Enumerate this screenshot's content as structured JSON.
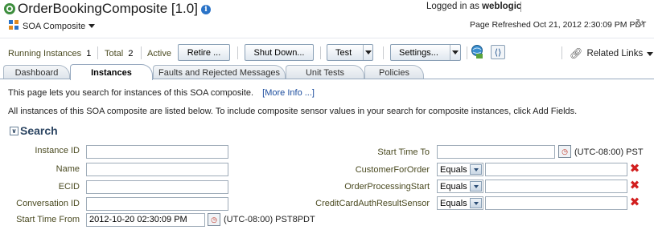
{
  "header": {
    "title": "OrderBookingComposite [1.0]",
    "logged_in_prefix": "Logged in as",
    "user": "weblogic",
    "soa_menu_label": "SOA Composite",
    "page_refreshed": "Page Refreshed Oct 21, 2012 2:30:09 PM PDT"
  },
  "toolbar": {
    "running_label": "Running Instances",
    "running_count": "1",
    "total_label": "Total",
    "total_count": "2",
    "status": "Active",
    "retire_label": "Retire ...",
    "shutdown_label": "Shut Down...",
    "test_label": "Test",
    "settings_label": "Settings...",
    "related_links_label": "Related Links"
  },
  "tabs": [
    {
      "label": "Dashboard",
      "active": false
    },
    {
      "label": "Instances",
      "active": true
    },
    {
      "label": "Faults and Rejected Messages",
      "active": false
    },
    {
      "label": "Unit Tests",
      "active": false
    },
    {
      "label": "Policies",
      "active": false
    }
  ],
  "content": {
    "description": "This page lets you search for instances of this SOA composite.",
    "more_info": "[More Info ...]",
    "description2": "All instances of this SOA composite are listed below. To include composite sensor values in your search for composite instances, click Add Fields.",
    "search_title": "Search"
  },
  "search": {
    "left_fields": [
      {
        "label": "Instance ID",
        "value": ""
      },
      {
        "label": "Name",
        "value": ""
      },
      {
        "label": "ECID",
        "value": ""
      },
      {
        "label": "Conversation ID",
        "value": ""
      },
      {
        "label": "Start Time From",
        "value": "2012-10-20 02:30:09 PM",
        "timezone": "(UTC-08:00) PST8PDT"
      }
    ],
    "start_time_to": {
      "label": "Start Time To",
      "value": "",
      "timezone": "(UTC-08:00) PST"
    },
    "sensor_fields": [
      {
        "label": "CustomerForOrder",
        "operator": "Equals",
        "value": ""
      },
      {
        "label": "OrderProcessingStart",
        "operator": "Equals",
        "value": ""
      },
      {
        "label": "CreditCardAuthResultSensor",
        "operator": "Equals",
        "value": ""
      }
    ]
  },
  "colors": {
    "accent": "#2a73c7",
    "link": "#1a4b9c",
    "label_text": "#4a4a20",
    "remove": "#d21f1f"
  }
}
